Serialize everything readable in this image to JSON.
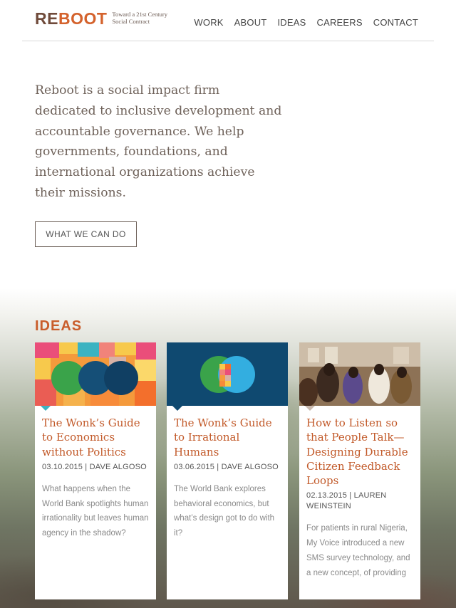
{
  "brand": {
    "name": "REBOOT",
    "tagline_line1": "Toward a 21st Century",
    "tagline_line2": "Social Contract"
  },
  "nav": [
    "WORK",
    "ABOUT",
    "IDEAS",
    "CAREERS",
    "CONTACT"
  ],
  "hero": {
    "text": "Reboot is a social impact firm dedicated to inclusive development and accountable governance. We help governments, foundations, and international organizations achieve their missions.",
    "cta_label": "WHAT WE CAN DO"
  },
  "ideas": {
    "heading": "IDEAS",
    "cards": [
      {
        "title": "The Wonk’s Guide to Economics without Politics",
        "meta": "03.10.2015 | DAVE ALGOSO",
        "excerpt": "What happens when the World Bank spotlights human irrationality but leaves human agency in the shadow?"
      },
      {
        "title": "The Wonk’s Guide to Irrational Humans",
        "meta": "03.06.2015 | DAVE ALGOSO",
        "excerpt": "The World Bank explores behavioral economics, but what’s design got to do with it?"
      },
      {
        "title": "How to Listen so that People Talk—Designing Durable Citizen Feedback Loops",
        "meta": "02.13.2015 | LAUREN WEINSTEIN",
        "excerpt": "For patients in rural Nigeria, My Voice introduced a new SMS survey technology, and a new concept, of providing"
      }
    ]
  },
  "colors": {
    "accent": "#c95d2b",
    "body_text": "#6e6159",
    "brand_brown": "#6f4a3a"
  }
}
